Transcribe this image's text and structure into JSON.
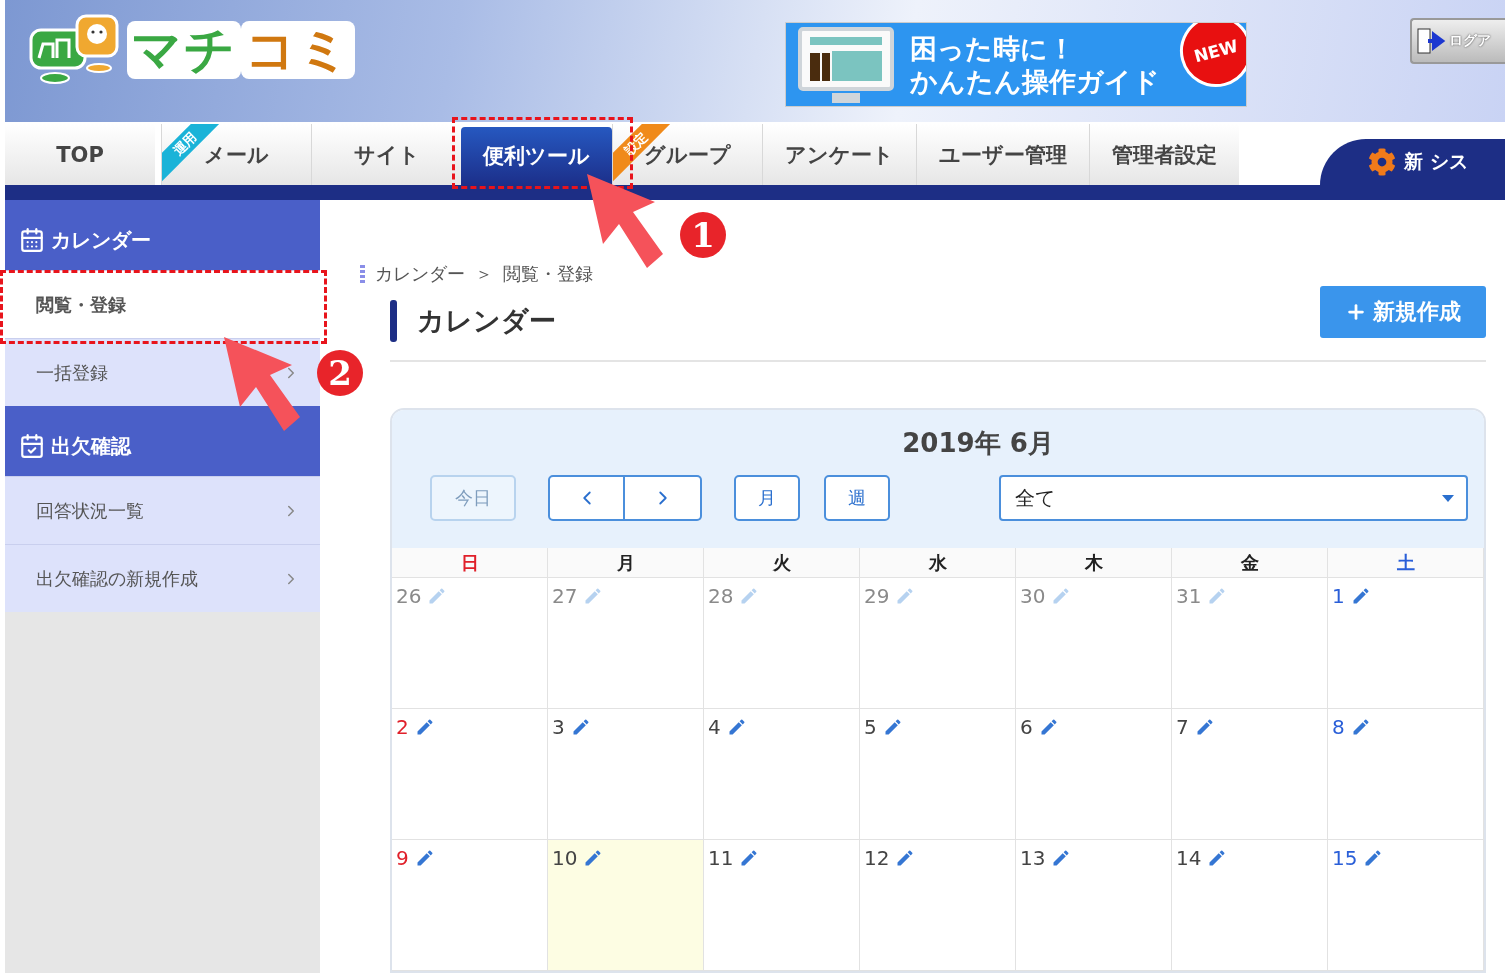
{
  "logo": {
    "parts": [
      {
        "text": "マチ",
        "color": "#3aa843"
      },
      {
        "text": "コミ",
        "color": "#d07810"
      }
    ]
  },
  "banner": {
    "lines": [
      "困った時に！",
      "かんたん操作ガイド"
    ],
    "badge": "NEW"
  },
  "logout": {
    "label": "ログア"
  },
  "nav": {
    "tabs": [
      {
        "label": "TOP",
        "selected": false
      },
      {
        "label": "メール",
        "selected": false,
        "ribbon": "運用",
        "color": "#1ab3d8"
      },
      {
        "label": "サイト",
        "selected": false
      },
      {
        "label": "便利ツール",
        "selected": true
      },
      {
        "label": "グループ",
        "selected": false,
        "ribbon": "設定",
        "color": "#f08a1a"
      },
      {
        "label": "アンケート",
        "selected": false
      },
      {
        "label": "ユーザー管理",
        "selected": false
      },
      {
        "label": "管理者設定",
        "selected": false
      }
    ],
    "notice": "新 シス"
  },
  "sidebar": {
    "sections": [
      {
        "title": "カレンダー",
        "kind": "calendar",
        "items": [
          {
            "label": "閲覧・登録",
            "selected": true
          },
          {
            "label": "一括登録",
            "selected": false
          }
        ]
      },
      {
        "title": "出欠確認",
        "kind": "check",
        "items": [
          {
            "label": "回答状況一覧",
            "selected": false
          },
          {
            "label": "出欠確認の新規作成",
            "selected": false
          }
        ]
      }
    ]
  },
  "breadcrumb": [
    "カレンダー",
    "＞",
    "閲覧・登録"
  ],
  "page_title": "カレンダー",
  "new_button": "新規作成",
  "calendar": {
    "title": "2019年 6月",
    "today_button": {
      "label": "今日",
      "disabled": true
    },
    "view_buttons": [
      "月",
      "週"
    ],
    "filter": {
      "value": "全て"
    },
    "weekdays": [
      {
        "label": "日",
        "color": "#e0202a"
      },
      {
        "label": "月",
        "color": "#222222"
      },
      {
        "label": "火",
        "color": "#222222"
      },
      {
        "label": "水",
        "color": "#222222"
      },
      {
        "label": "木",
        "color": "#222222"
      },
      {
        "label": "金",
        "color": "#222222"
      },
      {
        "label": "土",
        "color": "#2a5fd8"
      }
    ],
    "weeks": [
      [
        {
          "day": "26",
          "muted": true,
          "today": false
        },
        {
          "day": "27",
          "muted": true,
          "today": false
        },
        {
          "day": "28",
          "muted": true,
          "today": false
        },
        {
          "day": "29",
          "muted": true,
          "today": false
        },
        {
          "day": "30",
          "muted": true,
          "today": false
        },
        {
          "day": "31",
          "muted": true,
          "today": false
        },
        {
          "day": "1",
          "muted": false,
          "today": false
        }
      ],
      [
        {
          "day": "2",
          "muted": false,
          "today": false
        },
        {
          "day": "3",
          "muted": false,
          "today": false
        },
        {
          "day": "4",
          "muted": false,
          "today": false
        },
        {
          "day": "5",
          "muted": false,
          "today": false
        },
        {
          "day": "6",
          "muted": false,
          "today": false
        },
        {
          "day": "7",
          "muted": false,
          "today": false
        },
        {
          "day": "8",
          "muted": false,
          "today": false
        }
      ],
      [
        {
          "day": "9",
          "muted": false,
          "today": false
        },
        {
          "day": "10",
          "muted": false,
          "today": true
        },
        {
          "day": "11",
          "muted": false,
          "today": false
        },
        {
          "day": "12",
          "muted": false,
          "today": false
        },
        {
          "day": "13",
          "muted": false,
          "today": false
        },
        {
          "day": "14",
          "muted": false,
          "today": false
        },
        {
          "day": "15",
          "muted": false,
          "today": false
        }
      ]
    ]
  },
  "annotations": [
    {
      "number": "1"
    },
    {
      "number": "2"
    }
  ]
}
